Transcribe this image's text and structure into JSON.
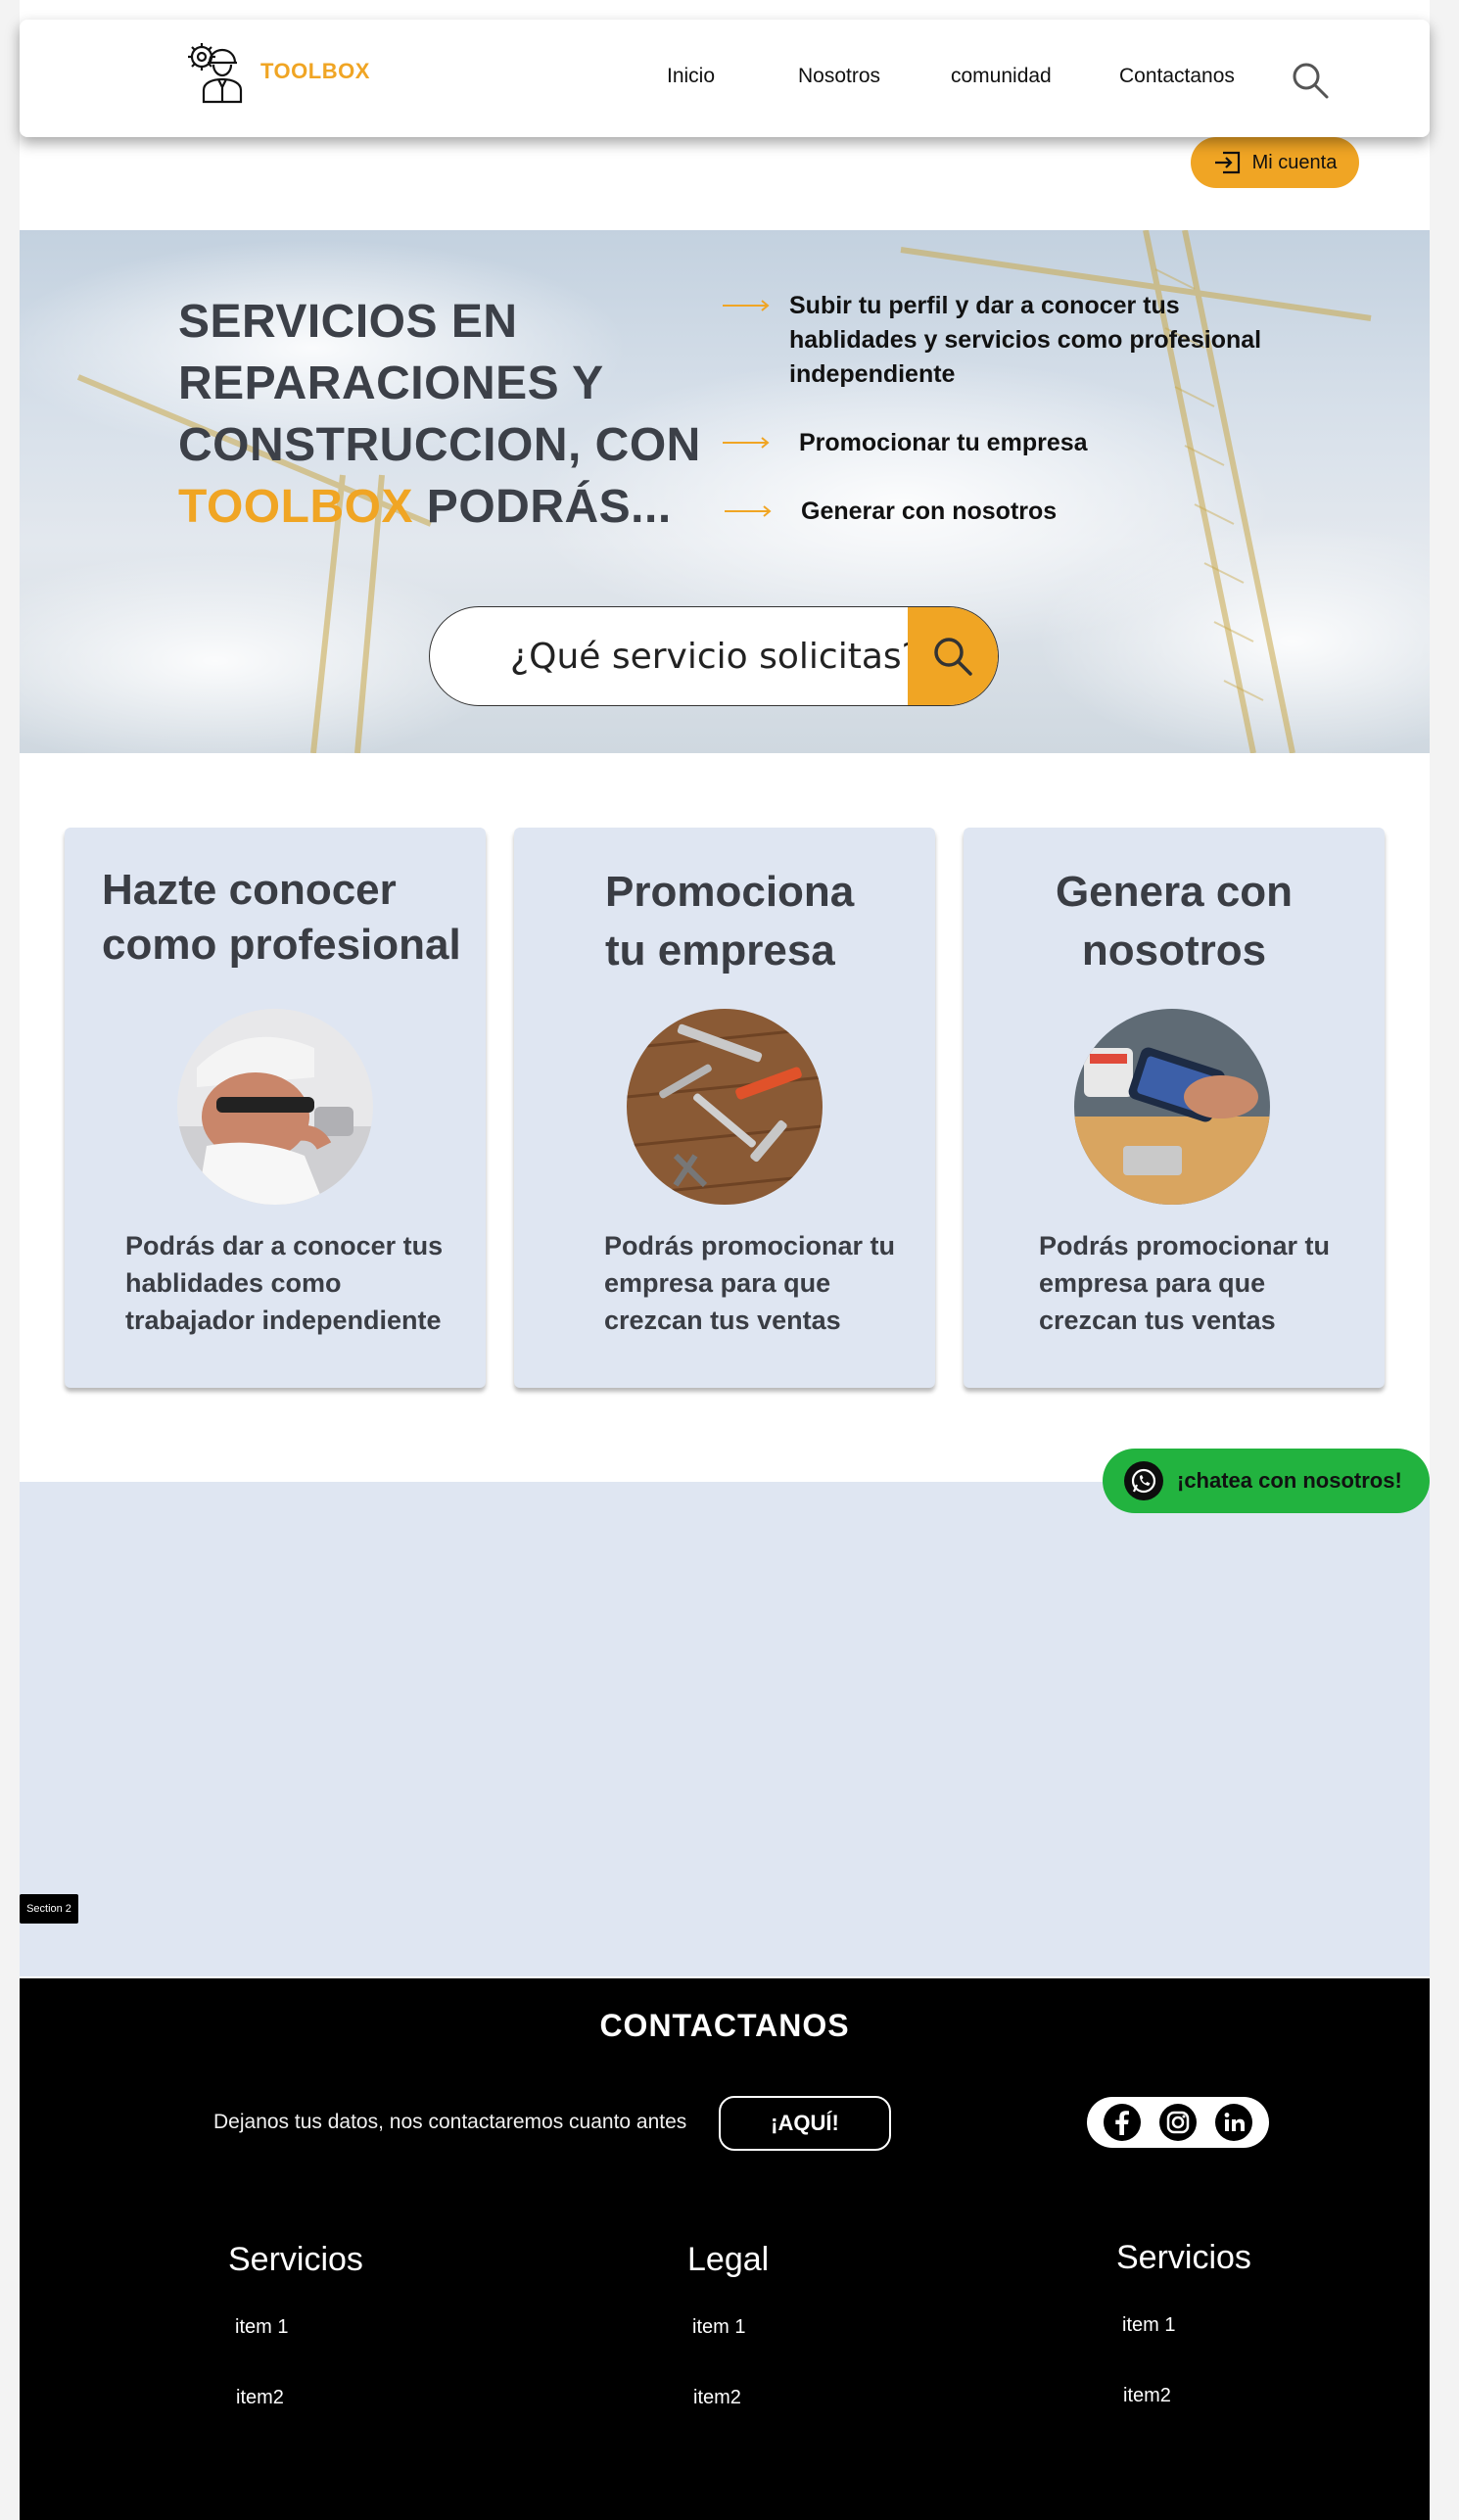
{
  "brand": {
    "name": "TOOLBOX",
    "accent": "#f0a524"
  },
  "nav": {
    "items": [
      "Inicio",
      "Nosotros",
      "comunidad",
      "Contactanos"
    ]
  },
  "account": {
    "label": "Mi cuenta"
  },
  "hero": {
    "title_line1": "SERVICIOS EN",
    "title_line2": "REPARACIONES Y",
    "title_line3": "CONSTRUCCION, CON",
    "title_accent": "TOOLBOX",
    "title_tail": " PODRÁS...",
    "benefits": [
      "Subir tu perfil y dar a conocer tus hablidades y servicios como profesional independiente",
      "Promocionar tu empresa",
      "Generar con nosotros"
    ],
    "search_placeholder": "¿Qué servicio solicitas?"
  },
  "cards": [
    {
      "title_1": "Hazte conocer",
      "title_2": "como profesional",
      "desc": "Podrás dar a conocer tus hablidades como trabajador independiente",
      "image": "electrician-icon-photo"
    },
    {
      "title_1": "Promociona",
      "title_2": "tu empresa",
      "desc": "Podrás promocionar tu empresa para que crezcan tus ventas",
      "image": "tools-photo"
    },
    {
      "title_1": "Genera con",
      "title_2": "nosotros",
      "desc": "Podrás promocionar tu empresa para que crezcan tus ventas",
      "image": "phone-payment-photo"
    }
  ],
  "chat": {
    "label": "¡chatea con nosotros!",
    "color": "#22b33f"
  },
  "section2": {
    "tag": "Section 2"
  },
  "footer": {
    "title": "CONTACTANOS",
    "cta_text": "Dejanos tus datos, nos contactaremos cuanto antes",
    "cta_button": "¡AQUÍ!",
    "social": [
      "facebook-icon",
      "instagram-icon",
      "linkedin-icon"
    ],
    "columns": [
      {
        "title": "Servicios",
        "links": [
          "item 1",
          "item2"
        ]
      },
      {
        "title": "Legal",
        "links": [
          "item 1",
          "item2"
        ]
      },
      {
        "title": "Servicios",
        "links": [
          "item 1",
          "item2"
        ]
      }
    ]
  }
}
